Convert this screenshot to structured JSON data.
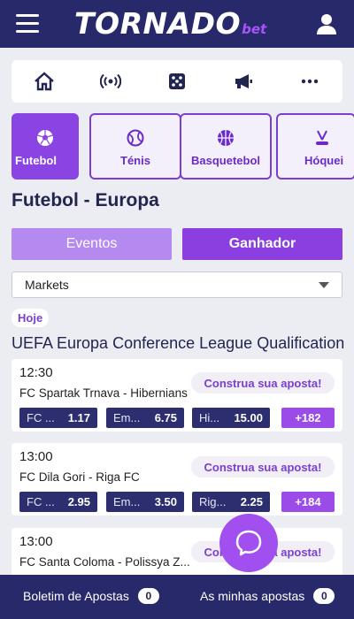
{
  "header": {
    "logo_main": "TORNADO",
    "logo_sub": "bet"
  },
  "quicknav": [
    "home-icon",
    "live-broadcast-icon",
    "dice-icon",
    "megaphone-icon",
    "more-icon"
  ],
  "sports": [
    {
      "label": "Futebol",
      "icon": "soccer-ball-icon",
      "active": true
    },
    {
      "label": "Ténis",
      "icon": "tennis-ball-icon"
    },
    {
      "label": "Basquetebol",
      "icon": "basketball-icon"
    },
    {
      "label": "Hóquei",
      "icon": "hockey-icon"
    }
  ],
  "page": {
    "title": "Futebol - Europa"
  },
  "toggles": {
    "events": "Eventos",
    "winner": "Ganhador"
  },
  "markets": {
    "selected": "Markets"
  },
  "day_badge": "Hoje",
  "league": "UEFA Europa Conference League Qualification",
  "matches": [
    {
      "time": "12:30",
      "teams": "FC Spartak Trnava - Hibernians",
      "bet_builder": "Construa sua aposta!",
      "odds": [
        {
          "name": "FC ...",
          "value": "1.17"
        },
        {
          "name": "Em...",
          "value": "6.75"
        },
        {
          "name": "Hi...",
          "value": "15.00"
        }
      ],
      "more": "+182"
    },
    {
      "time": "13:00",
      "teams": "FC Dila Gori - Riga FC",
      "bet_builder": "Construa sua aposta!",
      "odds": [
        {
          "name": "FC ...",
          "value": "2.95"
        },
        {
          "name": "Em...",
          "value": "3.50"
        },
        {
          "name": "Rig...",
          "value": "2.25"
        }
      ],
      "more": "+184"
    },
    {
      "time": "13:00",
      "teams": "FC Santa Coloma - Polissya Z...",
      "bet_builder": "Construa sua aposta!"
    }
  ],
  "footer": {
    "betslip_label": "Boletim de Apostas",
    "betslip_count": "0",
    "mybets_label": "As minhas apostas",
    "mybets_count": "0"
  },
  "colors": {
    "header": "#28296a",
    "accent": "#8b44e4",
    "odd_bg": "#2d2e70"
  }
}
